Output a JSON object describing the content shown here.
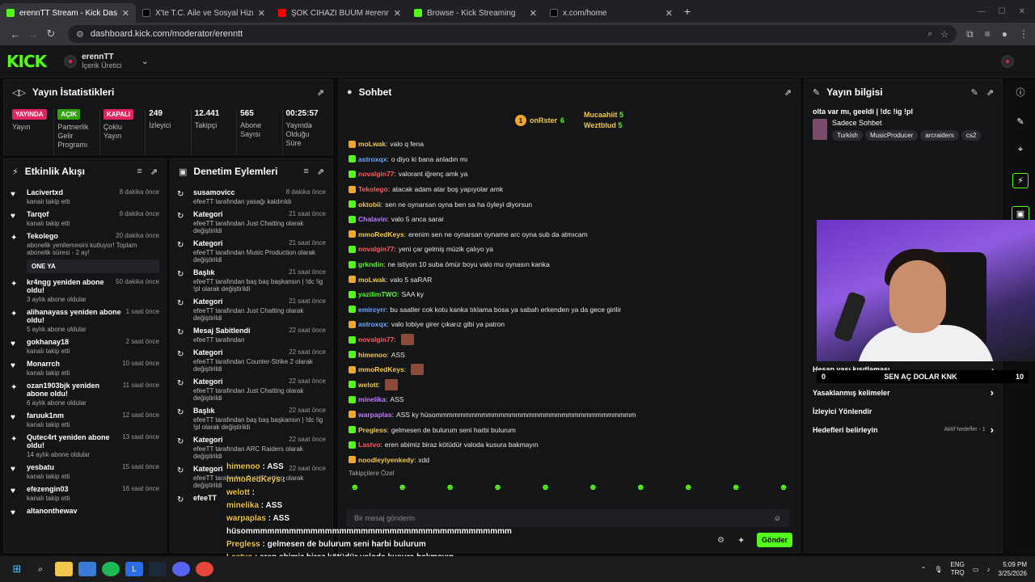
{
  "browser": {
    "tabs": [
      {
        "title": "erennTT Stream - Kick Dashboard",
        "color": "#53fc18",
        "active": true
      },
      {
        "title": "X'te T.C. Aile ve Sosyal Hizmetle",
        "color": "#000000",
        "active": false
      },
      {
        "title": "ŞOK CİHAZI BUUM #erenntt #k",
        "color": "#ff0000",
        "active": false
      },
      {
        "title": "Browse - Kick Streaming",
        "color": "#53fc18",
        "active": false
      },
      {
        "title": "x.com/home",
        "color": "#000000",
        "active": false
      }
    ],
    "url": "dashboard.kick.com/moderator/erenntt"
  },
  "header": {
    "logo": "KICK",
    "channel_name": "erennTT",
    "channel_role": "İçerik Üretici"
  },
  "stats": {
    "title": "Yayın İstatistikleri",
    "items": [
      {
        "pill": "YAYINDA",
        "pill_color": "#e0245e",
        "label": "Yayın"
      },
      {
        "pill": "AÇIK",
        "pill_color": "#2fa50a",
        "label": "Partnerlik Gelir Programı"
      },
      {
        "pill": "KAPALI",
        "pill_color": "#e0245e",
        "label": "Çoklu Yayın"
      },
      {
        "value": "249",
        "label": "İzleyici"
      },
      {
        "value": "12.441",
        "label": "Takipçi"
      },
      {
        "value": "565",
        "label": "Abone Sayısı"
      },
      {
        "value": "00:25:57",
        "label": "Yayında Olduğu Süre"
      }
    ]
  },
  "activity": {
    "title": "Etkinlik Akışı",
    "items": [
      {
        "icon": "heart",
        "name": "Lacivertxd",
        "time": "8 dakika önce",
        "sub": "kanalı takip etti"
      },
      {
        "icon": "heart",
        "name": "Tarqof",
        "time": "9 dakika önce",
        "sub": "kanalı takip etti"
      },
      {
        "icon": "star",
        "name": "Tekolego",
        "time": "20 dakika önce",
        "sub": "abonelik yenilemesini kutluyor! Toplam abonelik süresi - 2 ay!",
        "note": "ONE YA"
      },
      {
        "icon": "star",
        "name": "kr4ngg yeniden abone oldu!",
        "time": "50 dakika önce",
        "sub": "3 aylık abone oldular"
      },
      {
        "icon": "star",
        "name": "alihanayass yeniden abone oldu!",
        "time": "1 saat önce",
        "sub": "5 aylık abone oldular"
      },
      {
        "icon": "heart",
        "name": "gokhanay18",
        "time": "2 saat önce",
        "sub": "kanalı takip etti"
      },
      {
        "icon": "heart",
        "name": "Monarrch",
        "time": "10 saat önce",
        "sub": "kanalı takip etti"
      },
      {
        "icon": "star",
        "name": "ozan1903bjk yeniden abone oldu!",
        "time": "11 saat önce",
        "sub": "6 aylık abone oldular"
      },
      {
        "icon": "heart",
        "name": "faruuk1nm",
        "time": "12 saat önce",
        "sub": "kanalı takip etti"
      },
      {
        "icon": "star",
        "name": "Qutec4rt yeniden abone oldu!",
        "time": "13 saat önce",
        "sub": "14 aylık abone oldular"
      },
      {
        "icon": "heart",
        "name": "yesbatu",
        "time": "15 saat önce",
        "sub": "kanalı takip etti"
      },
      {
        "icon": "heart",
        "name": "efezengin03",
        "time": "16 saat önce",
        "sub": "kanalı takip etti"
      },
      {
        "icon": "heart",
        "name": "altanonthewav",
        "time": "",
        "sub": ""
      }
    ]
  },
  "modlog": {
    "title": "Denetim Eylemleri",
    "items": [
      {
        "name": "susamovicc",
        "time": "8 dakika önce",
        "sub": "efeeTT tarafından yasağı kaldırıldı"
      },
      {
        "name": "Kategori",
        "time": "21 saat önce",
        "sub": "efeeTT tarafından Just Chatting olarak değiştirildi"
      },
      {
        "name": "Kategori",
        "time": "21 saat önce",
        "sub": "efeeTT tarafından Music Production olarak değiştirildi"
      },
      {
        "name": "Başlık",
        "time": "21 saat önce",
        "sub": "efeeTT tarafından baş baş başkansın | !dc !ig !pl olarak değiştirildi"
      },
      {
        "name": "Kategori",
        "time": "21 saat önce",
        "sub": "efeeTT tarafından Just Chatting olarak değiştirildi"
      },
      {
        "name": "Mesaj Sabitlendi",
        "time": "22 saat önce",
        "sub": "efeeTT tarafından"
      },
      {
        "name": "Kategori",
        "time": "22 saat önce",
        "sub": "efeeTT tarafından Counter-Strike 2 olarak değiştirildi"
      },
      {
        "name": "Kategori",
        "time": "22 saat önce",
        "sub": "efeeTT tarafından Just Chatting olarak değiştirildi"
      },
      {
        "name": "Başlık",
        "time": "22 saat önce",
        "sub": "efeeTT tarafından baş baş başkansın | !dc !ig !pl olarak değiştirildi"
      },
      {
        "name": "Kategori",
        "time": "22 saat önce",
        "sub": "efeeTT tarafından ARC Raiders olarak değiştirildi"
      },
      {
        "name": "Kategori",
        "time": "22 saat önce",
        "sub": "efeeTT tarafından Just Chatting olarak değiştirildi"
      },
      {
        "name": "efeeTT",
        "time": "",
        "sub": ""
      }
    ]
  },
  "chat": {
    "title": "Sohbet",
    "top": [
      {
        "rank": "1",
        "name": "onRster",
        "sub": "6"
      },
      {
        "name": "Mucaahiit",
        "sub": "5"
      },
      {
        "name": "Weztblud",
        "sub": "5"
      }
    ],
    "messages": [
      {
        "user": "moLwak",
        "color": "#f2c94c",
        "text": "valo q fena"
      },
      {
        "user": "astroxqx",
        "color": "#6ea8ff",
        "text": "o diyo ki bana anladın mı"
      },
      {
        "user": "novalgin77",
        "color": "#ff5a5a",
        "text": "valorant iğrenç amk ya"
      },
      {
        "user": "Tekolego",
        "color": "#ff5a5a",
        "text": "atacak adam atar boş yapıyolar amk"
      },
      {
        "user": "oktobii",
        "color": "#f2c94c",
        "text": "sen ne oynarsan oyna ben sa ha öyleyi diyorsun"
      },
      {
        "user": "Chalavin",
        "color": "#c07bff",
        "text": "valo 5 anca sarar"
      },
      {
        "user": "mmoRedKeys",
        "color": "#f2c94c",
        "text": "erenim sen ne oynarsan oyname arc oyna sub da atmıcam"
      },
      {
        "user": "novalgin77",
        "color": "#ff5a5a",
        "text": "yeni çar gelmiş müzik çalıyo ya"
      },
      {
        "user": "grkndin",
        "color": "#53fc18",
        "text": "ne istiyon 10 suba ömür boyu valo mu oynasın kanka"
      },
      {
        "user": "moLwak",
        "color": "#f2c94c",
        "text": "valo 5 saRAR"
      },
      {
        "user": "yazilimTWO",
        "color": "#53fc18",
        "text": "SAA ky"
      },
      {
        "user": "emircyrr",
        "color": "#6ea8ff",
        "text": "bu saatler cok kotu kanka tıklama bosa ya sabah erkenden ya da gece girilir"
      },
      {
        "user": "astroxqx",
        "color": "#6ea8ff",
        "text": "valo lobiye girer çıkarız gibi ya patron"
      },
      {
        "user": "novalgin77",
        "color": "#ff5a5a",
        "text": ""
      },
      {
        "user": "himenoo",
        "color": "#f2c94c",
        "text": "ASS"
      },
      {
        "user": "mmoRedKeys",
        "color": "#f2c94c",
        "text": ""
      },
      {
        "user": "welott",
        "color": "#f2c94c",
        "text": ""
      },
      {
        "user": "minelika",
        "color": "#c07bff",
        "text": "ASS"
      },
      {
        "user": "warpaplas",
        "color": "#c07bff",
        "text": "ASS ky hüsommmmmmmmmmmmmmmmmmmmmmmmmmmmmmmmmmm"
      },
      {
        "user": "Pregless",
        "color": "#f2c94c",
        "text": "gelmesen de bulurum seni harbi bulurum"
      },
      {
        "user": "Lastvo",
        "color": "#ff5a5a",
        "text": "eren abimiz biraz kötüdür valoda kusura bakmayın"
      },
      {
        "user": "noodleyiyenkedy",
        "color": "#f2c94c",
        "text": "xdd"
      }
    ],
    "footer_label": "Takipçilere Özel",
    "input_placeholder": "Bir mesaj gönderin",
    "send_label": "Gönder"
  },
  "info": {
    "title": "Yayın bilgisi",
    "stream_title": "olta var mı, geeldi | !dc !ig !pl",
    "category": "Sadece Sohbet",
    "tags": [
      "Turkish",
      "MusicProducer",
      "arcraiders",
      "cs2"
    ],
    "settings": [
      {
        "label": "Hesap yaşı kısıtlaması",
        "chevron": true
      },
      {
        "label": "Yasaklanmış kelimeler",
        "chevron": true
      },
      {
        "label": "İzleyici Yönlendir",
        "chevron": false
      },
      {
        "label": "Hedefleri belirleyin",
        "extra": "Aktif hedefler - 1",
        "chevron": true
      }
    ]
  },
  "overlay": {
    "ticker_left": "0",
    "ticker_text": "SEN AÇ DOLAR KNK",
    "ticker_right": "10",
    "chat_echo": [
      {
        "user": "himenoo",
        "text": "ASS"
      },
      {
        "user": "mmoRedKeys",
        "text": ""
      },
      {
        "user": "welott",
        "text": ""
      },
      {
        "user": "minelika",
        "text": "ASS"
      },
      {
        "user": "warpaplas",
        "text": "ASS"
      },
      {
        "user": "",
        "text": "hüsommmmmmmmmmmmmmmmmmmmmmmmmmmmmmmmmmmmm"
      },
      {
        "user": "Pregless",
        "text": "gelmesen de bulurum seni harbi bulurum"
      },
      {
        "user": "Lastvo",
        "text": "eren abimiz biraz kötüdür valoda kusura bakmayın"
      },
      {
        "user": "noodleyiyenkedy",
        "text": ""
      }
    ]
  },
  "taskbar": {
    "lang1": "ENG",
    "lang2": "TRQ",
    "time": "5:09 PM",
    "date": "3/25/2026"
  }
}
